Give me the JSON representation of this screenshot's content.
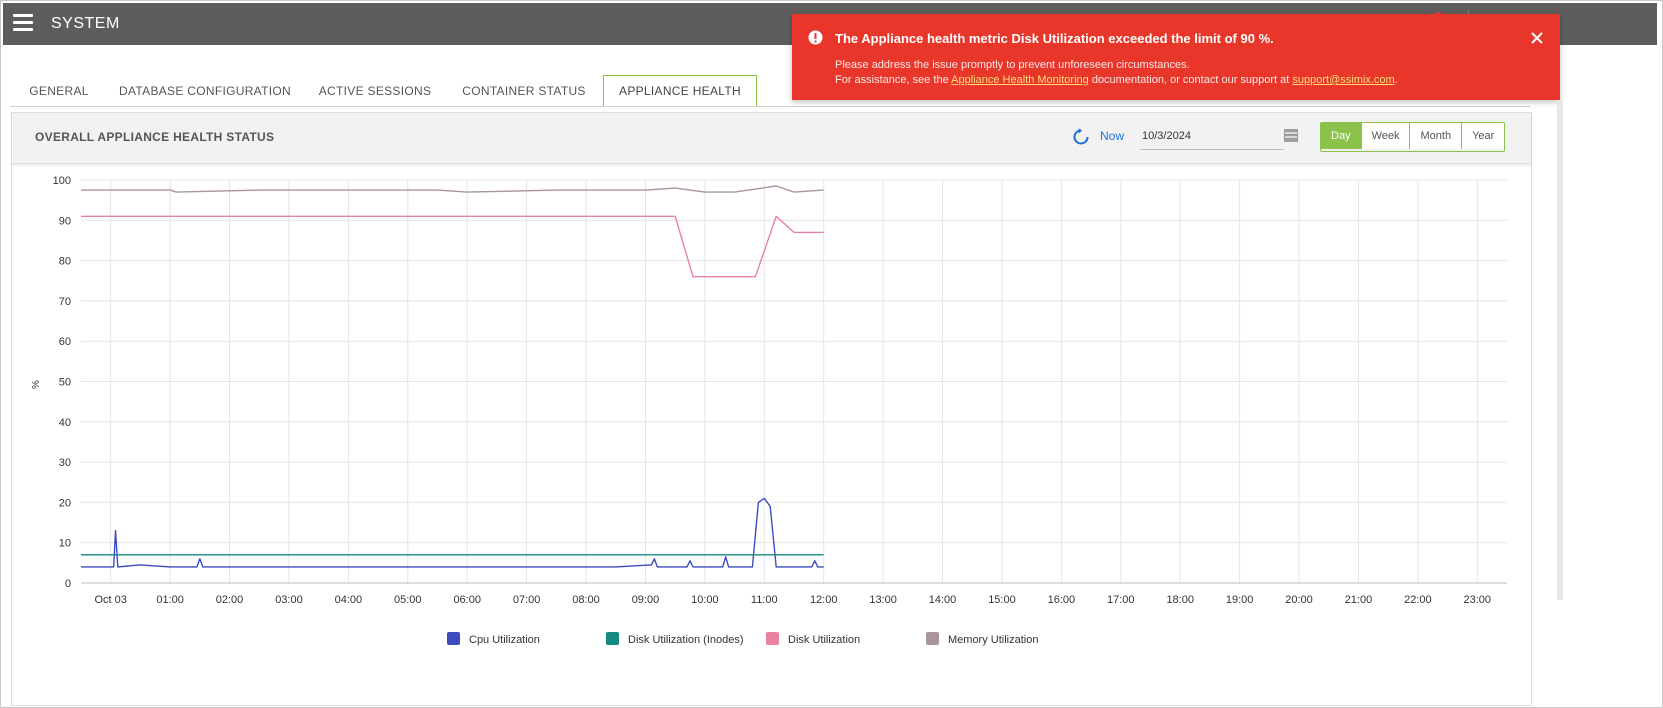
{
  "app": {
    "title": "SYSTEM"
  },
  "tabs": [
    {
      "label": "GENERAL"
    },
    {
      "label": "DATABASE CONFIGURATION"
    },
    {
      "label": "ACTIVE SESSIONS"
    },
    {
      "label": "CONTAINER STATUS"
    },
    {
      "label": "APPLIANCE HEALTH",
      "active": true
    }
  ],
  "panel": {
    "title": "OVERALL APPLIANCE HEALTH STATUS",
    "now_label": "Now",
    "date_value": "10/3/2024",
    "ranges": [
      {
        "label": "Day",
        "active": true
      },
      {
        "label": "Week"
      },
      {
        "label": "Month"
      },
      {
        "label": "Year"
      }
    ]
  },
  "alert": {
    "title": "The Appliance health metric Disk Utilization exceeded the limit of 90 %.",
    "line1": "Please address the issue promptly to prevent unforeseen circumstances.",
    "line2_prefix": "For assistance, see the ",
    "link1": "Appliance Health Monitoring",
    "line2_middle": " documentation, or contact our support at ",
    "link2": "support@ssimix.com",
    "line2_suffix": "."
  },
  "icons": {
    "menu": "hamburger-icon",
    "refresh": "refresh-icon",
    "calendar": "calendar-icon",
    "alert": "exclamation-icon",
    "close": "close-icon"
  },
  "colors": {
    "topbar": "#5d5d5d",
    "accent": "#8bc34a",
    "alert": "#e8372a",
    "link": "#1e6fd9"
  },
  "chart_data": {
    "type": "line",
    "ylabel": "%",
    "ylim": [
      0,
      100
    ],
    "y_ticks": [
      0,
      10,
      20,
      30,
      40,
      50,
      60,
      70,
      80,
      90,
      100
    ],
    "x_unit": "hours",
    "x_range": [
      0,
      24
    ],
    "x_ticks": [
      {
        "x": 0.5,
        "label": "Oct 03"
      },
      {
        "x": 1.5,
        "label": "01:00"
      },
      {
        "x": 2.5,
        "label": "02:00"
      },
      {
        "x": 3.5,
        "label": "03:00"
      },
      {
        "x": 4.5,
        "label": "04:00"
      },
      {
        "x": 5.5,
        "label": "05:00"
      },
      {
        "x": 6.5,
        "label": "06:00"
      },
      {
        "x": 7.5,
        "label": "07:00"
      },
      {
        "x": 8.5,
        "label": "08:00"
      },
      {
        "x": 9.5,
        "label": "09:00"
      },
      {
        "x": 10.5,
        "label": "10:00"
      },
      {
        "x": 11.5,
        "label": "11:00"
      },
      {
        "x": 12.5,
        "label": "12:00"
      },
      {
        "x": 13.5,
        "label": "13:00"
      },
      {
        "x": 14.5,
        "label": "14:00"
      },
      {
        "x": 15.5,
        "label": "15:00"
      },
      {
        "x": 16.5,
        "label": "16:00"
      },
      {
        "x": 17.5,
        "label": "17:00"
      },
      {
        "x": 18.5,
        "label": "18:00"
      },
      {
        "x": 19.5,
        "label": "19:00"
      },
      {
        "x": 20.5,
        "label": "20:00"
      },
      {
        "x": 21.5,
        "label": "21:00"
      },
      {
        "x": 22.5,
        "label": "22:00"
      },
      {
        "x": 23.5,
        "label": "23:00"
      }
    ],
    "grid": true,
    "legend_position": "bottom",
    "series": [
      {
        "name": "Cpu Utilization",
        "color": "#3b4cc0",
        "points": [
          [
            0,
            4
          ],
          [
            0.3,
            4
          ],
          [
            0.55,
            4
          ],
          [
            0.58,
            13
          ],
          [
            0.62,
            4
          ],
          [
            1,
            4.5
          ],
          [
            1.5,
            4
          ],
          [
            1.95,
            4
          ],
          [
            2,
            6
          ],
          [
            2.05,
            4
          ],
          [
            3,
            4
          ],
          [
            4,
            4
          ],
          [
            5,
            4
          ],
          [
            6,
            4
          ],
          [
            7,
            4
          ],
          [
            8,
            4
          ],
          [
            9,
            4
          ],
          [
            9.6,
            4.5
          ],
          [
            9.65,
            6
          ],
          [
            9.7,
            4
          ],
          [
            10.2,
            4
          ],
          [
            10.25,
            5.5
          ],
          [
            10.3,
            4
          ],
          [
            10.8,
            4
          ],
          [
            10.85,
            6.5
          ],
          [
            10.9,
            4
          ],
          [
            11.3,
            4
          ],
          [
            11.4,
            20
          ],
          [
            11.5,
            21
          ],
          [
            11.6,
            19
          ],
          [
            11.7,
            4
          ],
          [
            12,
            4
          ],
          [
            12.3,
            4
          ],
          [
            12.35,
            5.5
          ],
          [
            12.4,
            4
          ],
          [
            12.5,
            4
          ]
        ]
      },
      {
        "name": "Disk Utilization (Inodes)",
        "color": "#138a7f",
        "points": [
          [
            0,
            7
          ],
          [
            12.5,
            7
          ]
        ]
      },
      {
        "name": "Disk Utilization",
        "color": "#e8829e",
        "points": [
          [
            0,
            91
          ],
          [
            10.0,
            91
          ],
          [
            10.3,
            76
          ],
          [
            10.85,
            76
          ],
          [
            11.35,
            76
          ],
          [
            11.7,
            91
          ],
          [
            12.0,
            87
          ],
          [
            12.5,
            87
          ]
        ]
      },
      {
        "name": "Memory Utilization",
        "color": "#a8969c",
        "points": [
          [
            0,
            97.5
          ],
          [
            1.5,
            97.5
          ],
          [
            1.6,
            97
          ],
          [
            3,
            97.5
          ],
          [
            5,
            97.5
          ],
          [
            6,
            97.5
          ],
          [
            6.5,
            97
          ],
          [
            8,
            97.5
          ],
          [
            9.5,
            97.5
          ],
          [
            10,
            98
          ],
          [
            10.5,
            97
          ],
          [
            11,
            97
          ],
          [
            11.7,
            98.5
          ],
          [
            12,
            97
          ],
          [
            12.5,
            97.5
          ]
        ]
      }
    ]
  }
}
